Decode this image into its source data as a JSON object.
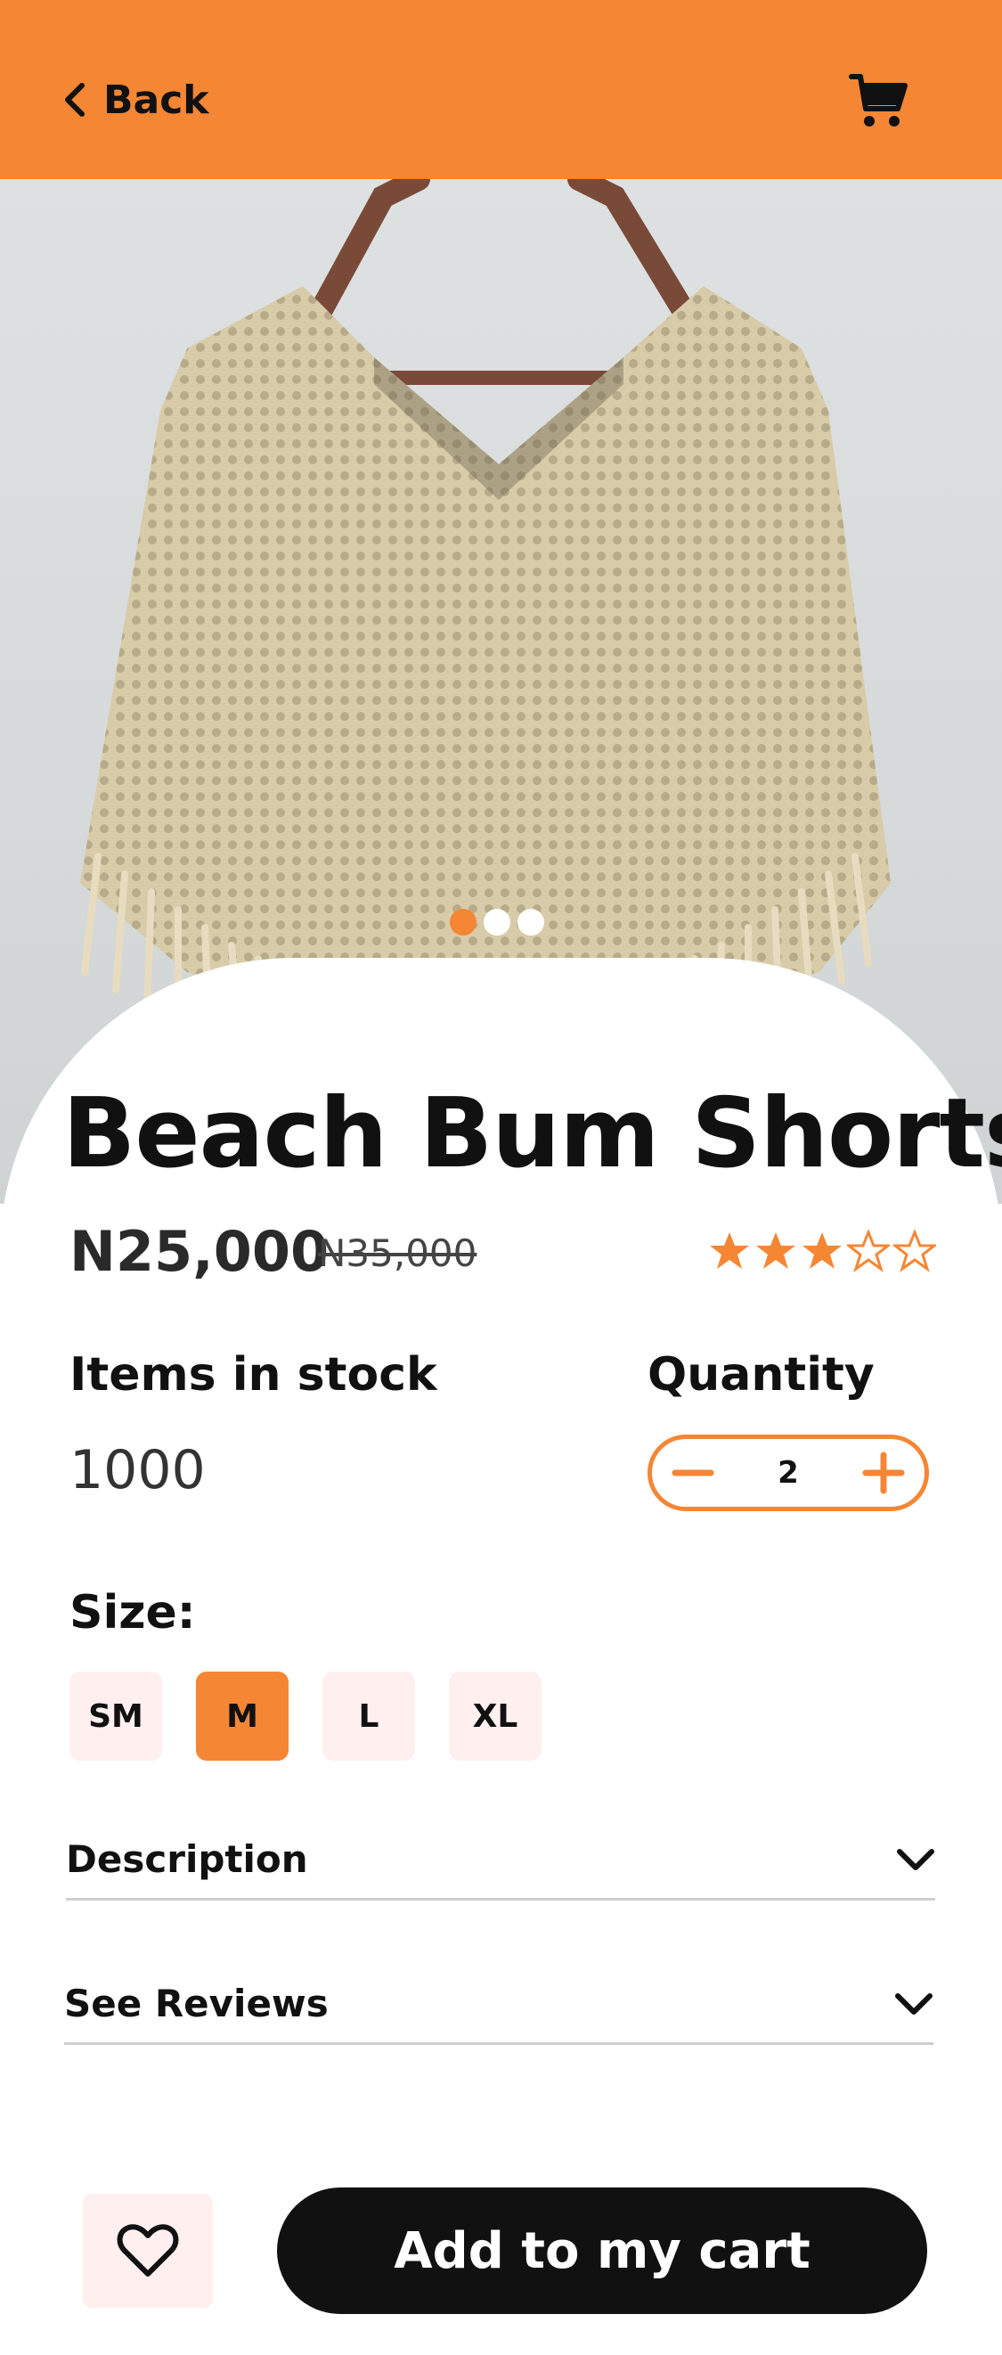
{
  "header": {
    "back_label": "Back",
    "back_icon": "chevron-left-icon",
    "cart_icon": "cart-icon",
    "background": "#F58634"
  },
  "product": {
    "image_description_icon": "product-photo",
    "carousel": {
      "total": 3,
      "active": 1
    },
    "title": "Beach Bum Shorts",
    "price": "N25,000",
    "old_price": "N35,000",
    "rating": {
      "value": 3,
      "max": 5
    },
    "stock_label": "Items in stock",
    "stock_value": "1000",
    "quantity_label": "Quantity",
    "quantity_value": "2",
    "size_label": "Size:",
    "sizes": [
      "SM",
      "M",
      "L",
      "XL"
    ],
    "selected_size": "M"
  },
  "sections": {
    "description_label": "Description",
    "reviews_label": "See Reviews"
  },
  "actions": {
    "favorite_icon": "heart-icon",
    "add_to_cart_label": "Add to my cart"
  },
  "colors": {
    "accent": "#F58634",
    "chip_bg": "#FFF0EF",
    "cta_bg": "#111111"
  }
}
